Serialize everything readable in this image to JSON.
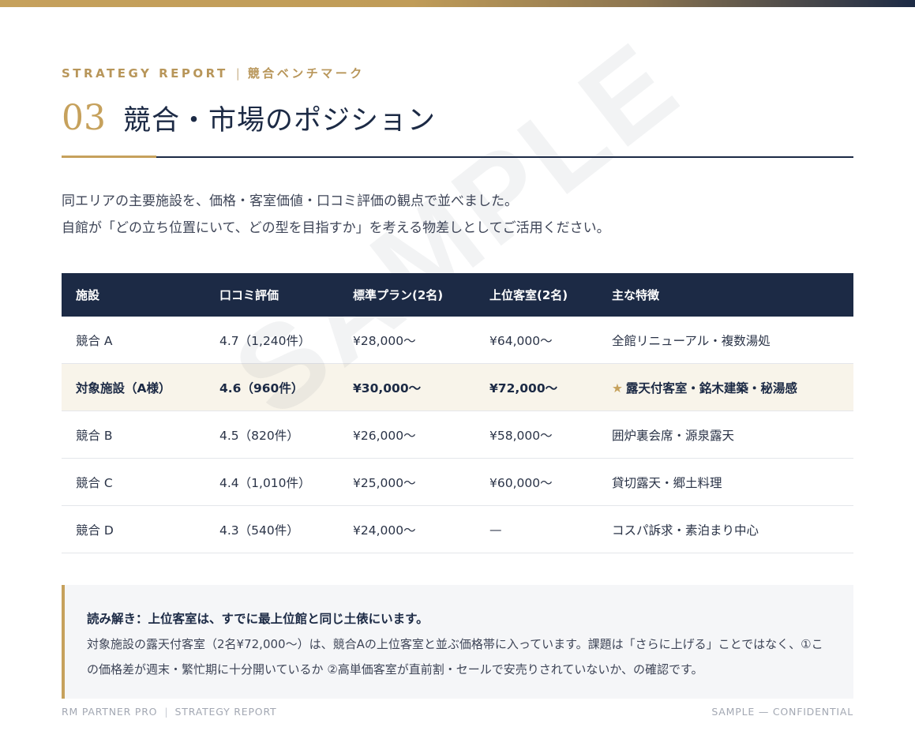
{
  "header": {
    "eyebrow_en": "STRATEGY REPORT",
    "eyebrow_sep": "|",
    "eyebrow_jp": "競合ベンチマーク",
    "section_number": "03",
    "title": "競合・市場のポジション"
  },
  "intro": {
    "line1": "同エリアの主要施設を、価格・客室価値・口コミ評価の観点で並べました。",
    "line2": "自館が「どの立ち位置にいて、どの型を目指すか」を考える物差しとしてご活用ください。"
  },
  "watermark": "SAMPLE",
  "table": {
    "headers": [
      "施設",
      "口コミ評価",
      "標準プラン(2名)",
      "上位客室(2名)",
      "主な特徴"
    ],
    "rows": [
      {
        "facility": "競合 A",
        "rating": "4.7（1,240件）",
        "standard": "¥28,000〜",
        "premium": "¥64,000〜",
        "features": "全館リニューアル・複数湯処"
      },
      {
        "facility": "対象施設（A様）",
        "rating": "4.6（960件）",
        "standard": "¥30,000〜",
        "premium": "¥72,000〜",
        "features": "露天付客室・銘木建築・秘湯感",
        "star": "★"
      },
      {
        "facility": "競合 B",
        "rating": "4.5（820件）",
        "standard": "¥26,000〜",
        "premium": "¥58,000〜",
        "features": "囲炉裏会席・源泉露天"
      },
      {
        "facility": "競合 C",
        "rating": "4.4（1,010件）",
        "standard": "¥25,000〜",
        "premium": "¥60,000〜",
        "features": "貸切露天・郷土料理"
      },
      {
        "facility": "競合 D",
        "rating": "4.3（540件）",
        "standard": "¥24,000〜",
        "premium": "—",
        "features": "コスパ訴求・素泊まり中心"
      }
    ]
  },
  "note": {
    "title": "読み解き：上位客室は、すでに最上位館と同じ土俵にいます。",
    "body": "対象施設の露天付客室（2名¥72,000〜）は、競合Aの上位客室と並ぶ価格帯に入っています。課題は「さらに上げる」ことではなく、①この価格差が週末・繁忙期に十分開いているか ②高単価客室が直前割・セールで安売りされていないか、の確認です。"
  },
  "footer": {
    "brand": "RM PARTNER PRO",
    "sep": "|",
    "report": "STRATEGY REPORT",
    "right": "SAMPLE — CONFIDENTIAL"
  }
}
